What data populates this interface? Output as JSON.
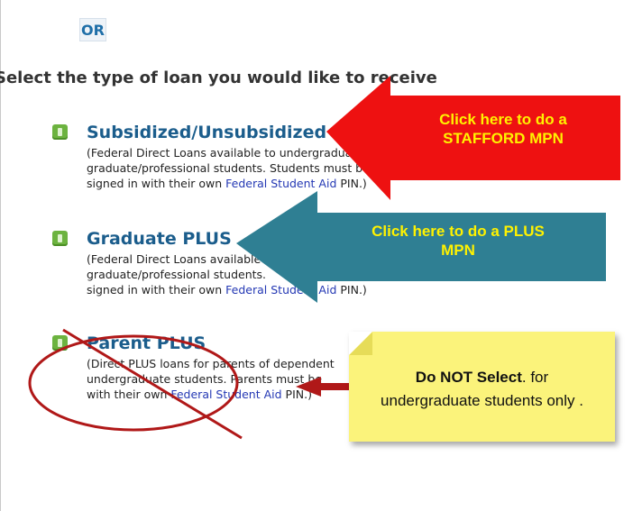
{
  "or_label": "OR",
  "heading": "Select the type of loan you would like to receive",
  "loans": [
    {
      "title": "Subsidized/Unsubsidized",
      "desc_a": "(Federal Direct Loans available to undergraduate and",
      "desc_b": "graduate/professional students. Students must be",
      "desc_c": "signed in with their own ",
      "link": "Federal Student Aid",
      "desc_d": " PIN.)"
    },
    {
      "title": "Graduate PLUS",
      "desc_a": "(Federal Direct Loans available to",
      "desc_b": "graduate/professional students.",
      "desc_c": "signed in with their own ",
      "link": "Federal Student Aid",
      "desc_d": " PIN.)"
    },
    {
      "title": "Parent PLUS",
      "desc_a": "(Direct PLUS loans for parents of dependent",
      "desc_b": "undergraduate students. Parents must be",
      "desc_c": "with their own ",
      "link": "Federal Student Aid",
      "desc_d": " PIN.)"
    }
  ],
  "callouts": {
    "stafford_line1": "Click here to do a",
    "stafford_line2": "STAFFORD MPN",
    "plus_line1": "Click here to do a PLUS",
    "plus_line2": "MPN",
    "note_bold": "Do NOT Select",
    "note_rest1": ". for",
    "note_rest2": "undergraduate students only ."
  },
  "colors": {
    "red_arrow": "#ee1111",
    "teal_arrow": "#2f7f93",
    "callout_text": "#fff200",
    "note_bg": "#fbf37b",
    "circle": "#b01818"
  }
}
